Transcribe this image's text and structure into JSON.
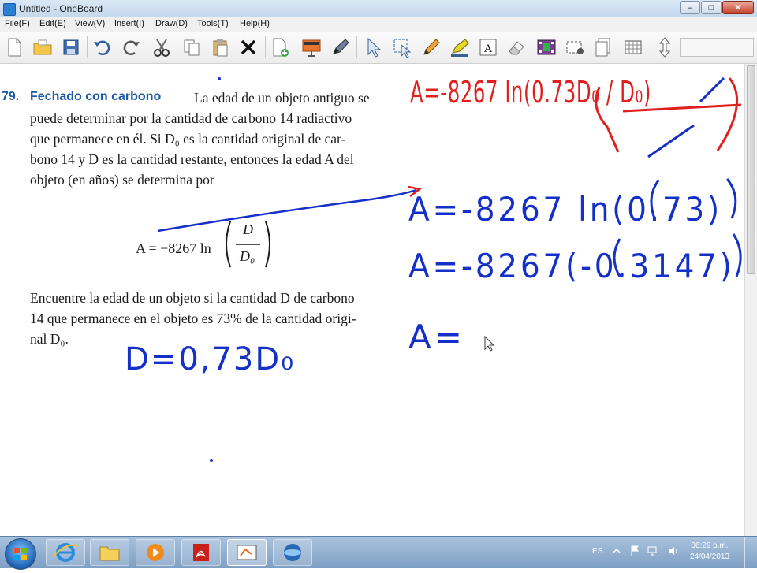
{
  "window": {
    "title": "Untitled - OneBoard",
    "minimize": "–",
    "maximize": "□",
    "close": "✕"
  },
  "menu": [
    "File(F)",
    "Edit(E)",
    "View(V)",
    "Insert(I)",
    "Draw(D)",
    "Tools(T)",
    "Help(H)"
  ],
  "toolbar": {
    "icons": [
      "new-page-icon",
      "open-folder-icon",
      "save-icon",
      "undo-icon",
      "redo-icon",
      "cut-icon",
      "copy-icon",
      "paste-icon",
      "delete-icon",
      "add-page-icon",
      "slide-icon",
      "marker-icon",
      "select-arrow-icon",
      "select-region-icon",
      "pen-icon",
      "highlighter-icon",
      "text-icon",
      "eraser-icon",
      "video-icon",
      "screen-capture-icon",
      "page-layout-icon",
      "grid-icon",
      "scroll-icon"
    ]
  },
  "problem": {
    "number": "79.",
    "title": "Fechado con carbono",
    "line1": "La edad de un objeto antiguo se",
    "lines": [
      "puede determinar por la cantidad de carbono 14 radiactivo",
      "que permanece en él. Si D₀ es la cantidad original de car-",
      "bono 14 y D es la cantidad restante, entonces la edad A del",
      "objeto (en años) se determina por"
    ],
    "formula_lhs": "A = −8267 ln",
    "formula_num": "D",
    "formula_den": "D₀",
    "question": [
      "Encuentre la edad de un objeto si la cantidad D de carbono",
      "14 que permanece en el objeto es 73% de la cantidad origi-",
      "nal D₀."
    ]
  },
  "handwriting": {
    "red_eq": "A=-8267 ln(0.73D₀ / D₀)",
    "blue_d": "D=0,73D₀",
    "blue_line1": "A=-8267 ln(0.73)",
    "blue_line2": "A=-8267(-0.3147)",
    "blue_line3": "A=",
    "ink_red": "#e0201e",
    "ink_blue": "#1430c8"
  },
  "tray": {
    "language": "ES",
    "time": "06:29 p.m.",
    "date": "24/04/2013"
  }
}
